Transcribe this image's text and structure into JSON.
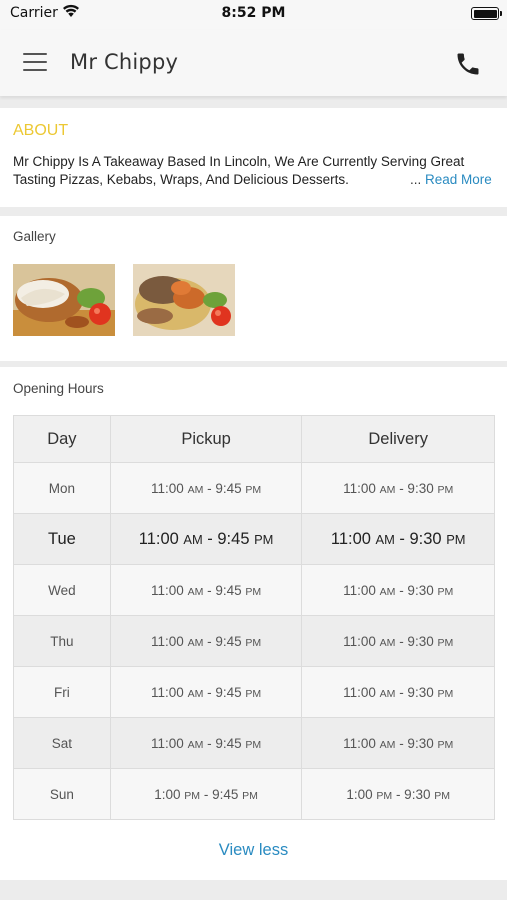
{
  "status_bar": {
    "carrier": "Carrier",
    "time": "8:52 PM"
  },
  "header": {
    "title": "Mr  Chippy",
    "menu_icon": "hamburger-menu-icon",
    "call_icon": "phone-icon"
  },
  "about": {
    "title": "ABOUT",
    "text": "Mr Chippy Is A Takeaway Based In Lincoln, We Are Currently Serving Great Tasting Pizzas, Kebabs, Wraps, And Delicious Desserts.",
    "ellipsis": "...",
    "read_more": "Read More"
  },
  "gallery": {
    "label": "Gallery"
  },
  "opening_hours": {
    "label": "Opening Hours",
    "columns": [
      "Day",
      "Pickup",
      "Delivery"
    ],
    "rows": [
      {
        "day": "Mon",
        "pickup": "11:00 AM - 9:45 PM",
        "delivery": "11:00 AM - 9:30 PM"
      },
      {
        "day": "Tue",
        "pickup": "11:00 AM - 9:45 PM",
        "delivery": "11:00 AM - 9:30 PM"
      },
      {
        "day": "Wed",
        "pickup": "11:00 AM - 9:45 PM",
        "delivery": "11:00 AM - 9:30 PM"
      },
      {
        "day": "Thu",
        "pickup": "11:00 AM - 9:45 PM",
        "delivery": "11:00 AM - 9:30 PM"
      },
      {
        "day": "Fri",
        "pickup": "11:00 AM - 9:45 PM",
        "delivery": "11:00 AM - 9:30 PM"
      },
      {
        "day": "Sat",
        "pickup": "11:00 AM - 9:45 PM",
        "delivery": "11:00 AM - 9:30 PM"
      },
      {
        "day": "Sun",
        "pickup": "1:00 PM - 9:45 PM",
        "delivery": "1:00 PM - 9:30 PM"
      }
    ],
    "highlighted_day": "Tue",
    "toggle_label": "View less"
  },
  "colors": {
    "accent_yellow": "#ecc833",
    "link_blue": "#2a8bc1"
  }
}
